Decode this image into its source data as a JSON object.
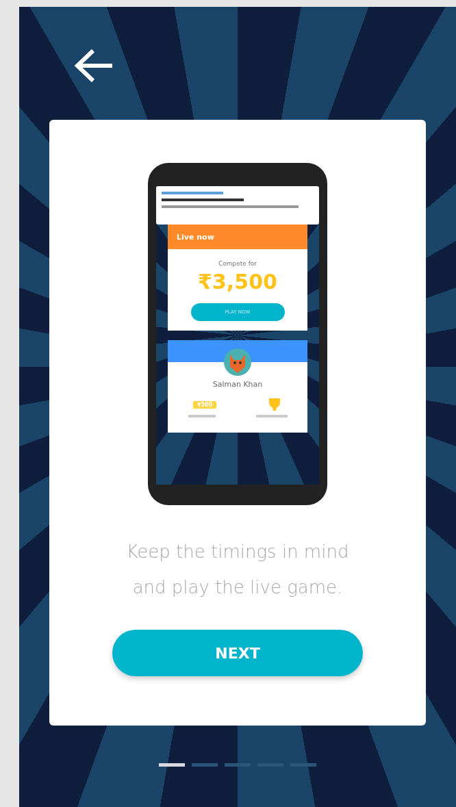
{
  "mockup": {
    "live_card": {
      "header": "Live now",
      "subtitle": "Compete for",
      "prize": "₹3,500",
      "button": "PLAY NOW"
    },
    "profile_card": {
      "name": "Salman Khan",
      "balance": "₹500"
    }
  },
  "caption": "Keep the timings in mind and play the live game.",
  "next_button": "NEXT",
  "pager": [
    {
      "selected": true
    },
    {
      "selected": false
    },
    {
      "selected": false
    },
    {
      "selected": false
    },
    {
      "selected": false
    }
  ]
}
